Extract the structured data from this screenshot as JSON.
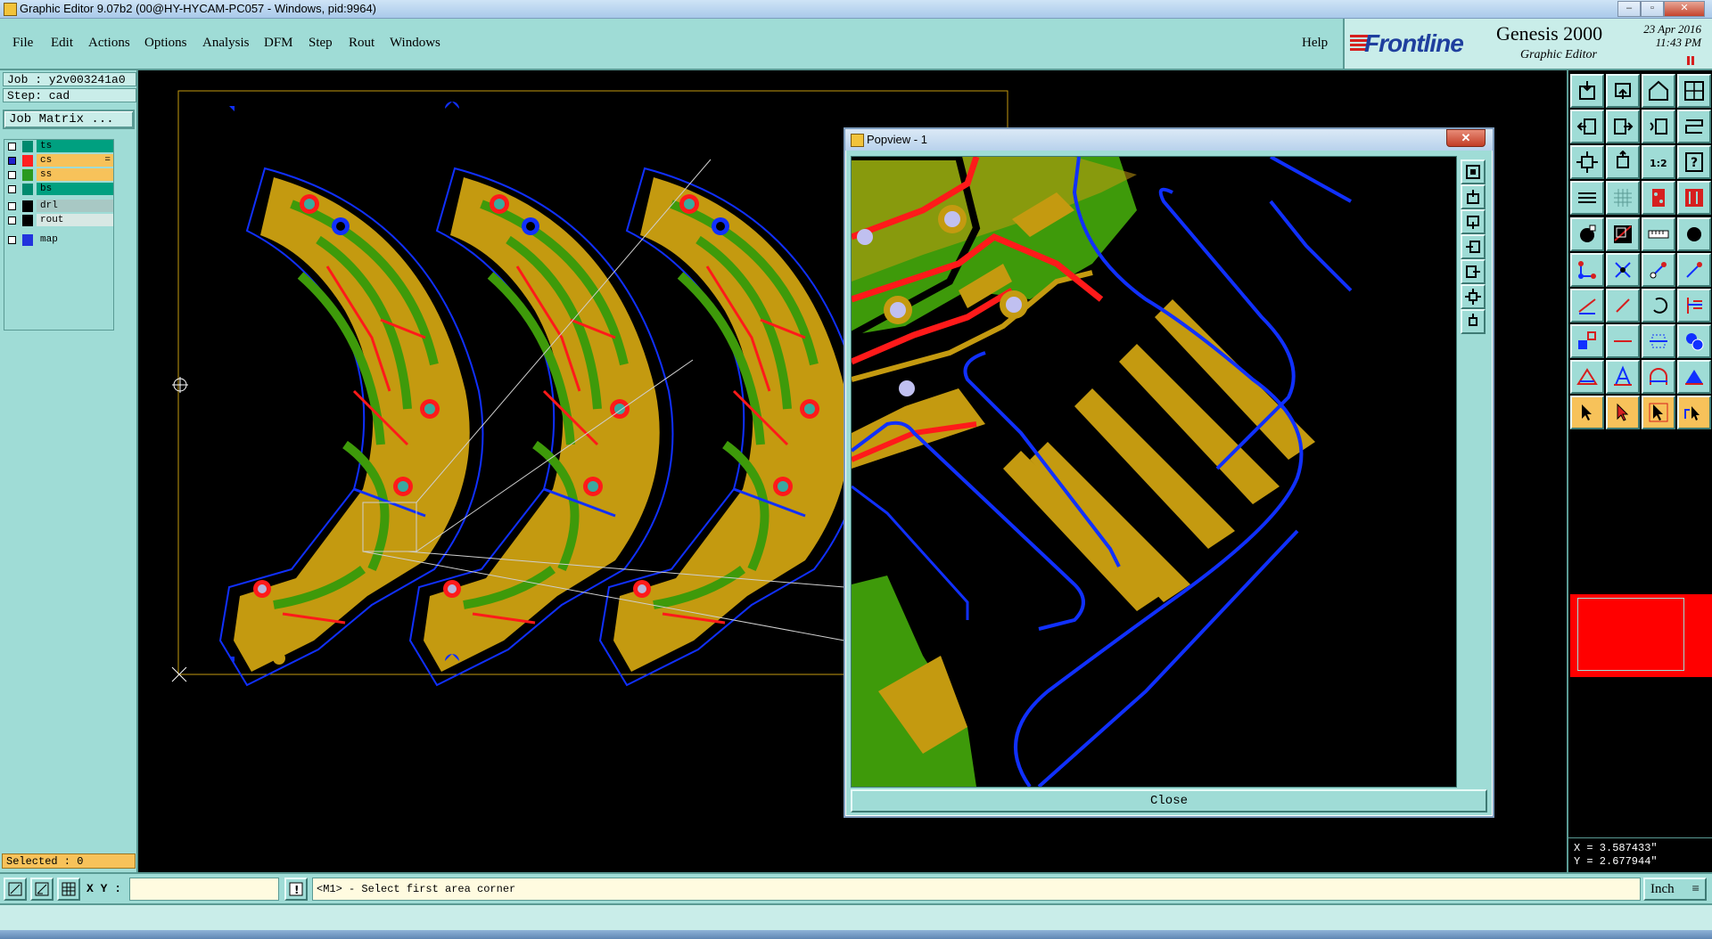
{
  "window": {
    "title": "Graphic Editor 9.07b2 (00@HY-HYCAM-PC057 - Windows, pid:9964)",
    "controls": [
      "minimize-icon",
      "maximize-icon",
      "close-icon"
    ]
  },
  "menu": {
    "items": [
      "File",
      "Edit",
      "Actions",
      "Options",
      "Analysis",
      "DFM",
      "Step",
      "Rout",
      "Windows"
    ],
    "help": "Help"
  },
  "brand": {
    "company": "Frontline",
    "product": "Genesis 2000",
    "subtitle": "Graphic Editor",
    "date": "23 Apr 2016",
    "time": "11:43 PM"
  },
  "job": {
    "job_label": "Job : y2v003241a0",
    "step_label": "Step: cad",
    "matrix_button": "Job Matrix ...",
    "selected": "Selected : 0"
  },
  "layers": [
    {
      "name": "ts",
      "color": "#008a6e",
      "checked": false,
      "bg": "#00a080"
    },
    {
      "name": "cs",
      "color": "#ff2020",
      "checked": true,
      "bg": "#f7c25a",
      "mark": "="
    },
    {
      "name": "ss",
      "color": "#2a9a20",
      "checked": false,
      "bg": "#f7c25a"
    },
    {
      "name": "bs",
      "color": "#008a6e",
      "checked": false,
      "bg": "#00a080"
    },
    {
      "name": "drl",
      "color": "#000000",
      "checked": false,
      "bg": "#a8c8c4"
    },
    {
      "name": "rout",
      "color": "#000000",
      "checked": false,
      "bg": "#d8e8e4"
    },
    {
      "name": "map",
      "color": "#2233dd",
      "checked": false,
      "bg": "#9fdcd6"
    }
  ],
  "popview": {
    "title": "Popview - 1",
    "close_label": "Close",
    "close_x": "✕"
  },
  "status": {
    "xy_label": "X Y :",
    "xy_value": "",
    "prompt": "<M1> - Select first area corner",
    "unit": "Inch",
    "coord_x": "X = 3.587433\"",
    "coord_y": "Y = 2.677944\""
  },
  "colors": {
    "panel": "#9fdcd6",
    "copper": "#c49a10",
    "soldermask": "#3e9a0a",
    "trace": "#ff1a1a",
    "outline": "#1030ff"
  }
}
